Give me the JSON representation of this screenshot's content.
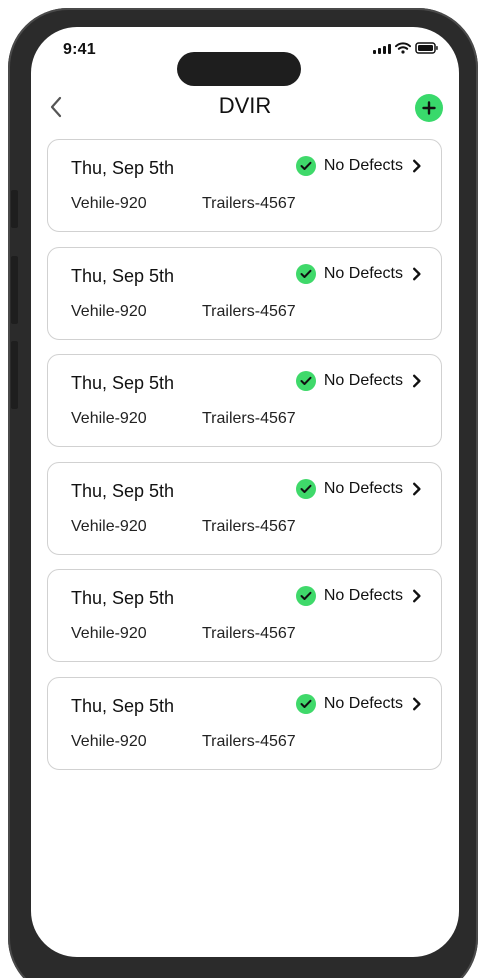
{
  "status_bar": {
    "time": "9:41"
  },
  "header": {
    "title": "DVIR"
  },
  "records": [
    {
      "date": "Thu, Sep 5th",
      "status": "No Defects",
      "vehicle": "Vehile-920",
      "trailer": "Trailers-4567"
    },
    {
      "date": "Thu, Sep 5th",
      "status": "No Defects",
      "vehicle": "Vehile-920",
      "trailer": "Trailers-4567"
    },
    {
      "date": "Thu, Sep 5th",
      "status": "No Defects",
      "vehicle": "Vehile-920",
      "trailer": "Trailers-4567"
    },
    {
      "date": "Thu, Sep 5th",
      "status": "No Defects",
      "vehicle": "Vehile-920",
      "trailer": "Trailers-4567"
    },
    {
      "date": "Thu, Sep 5th",
      "status": "No Defects",
      "vehicle": "Vehile-920",
      "trailer": "Trailers-4567"
    },
    {
      "date": "Thu, Sep 5th",
      "status": "No Defects",
      "vehicle": "Vehile-920",
      "trailer": "Trailers-4567"
    }
  ],
  "icons": {
    "back": "chevron-left-icon",
    "add": "plus-icon",
    "status": "check-circle-icon",
    "open_record": "chevron-right-icon",
    "cellular": "signal-icon",
    "wifi": "wifi-icon",
    "battery": "battery-icon"
  },
  "colors": {
    "accent_green": "#39d96b",
    "card_border": "#d1d1d1",
    "text": "#111111"
  }
}
